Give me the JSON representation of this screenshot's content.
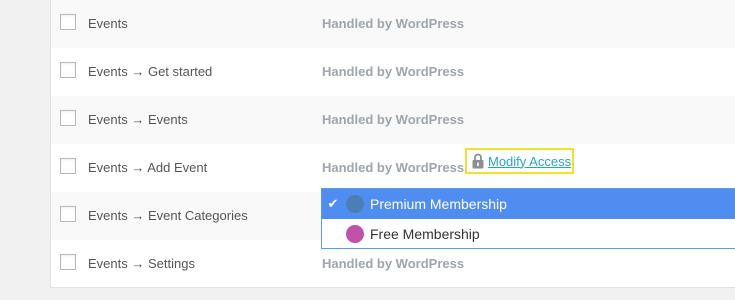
{
  "rows": [
    {
      "name": "Events",
      "access": "Handled by WordPress"
    },
    {
      "name": "Events → Get started",
      "access": "Handled by WordPress"
    },
    {
      "name": "Events → Events",
      "access": "Handled by WordPress"
    },
    {
      "name": "Events → Add Event",
      "access": "Handled by WordPress",
      "action": "Modify Access"
    },
    {
      "name": "Events → Event Categories",
      "access": ""
    },
    {
      "name": "Events → Settings",
      "access": "Handled by WordPress"
    }
  ],
  "dropdown": {
    "options": [
      {
        "label": "Premium Membership",
        "selected": true,
        "color": "#4a7fb5"
      },
      {
        "label": "Free Membership",
        "selected": false,
        "color": "#c152a9"
      }
    ]
  },
  "colors": {
    "highlight_border": "#f0e12a",
    "link": "#2aa3c6",
    "selected_bg": "#4f8ef0"
  },
  "icons": {
    "selected_marker": "checkmark-icon",
    "modify": "lock-icon"
  }
}
